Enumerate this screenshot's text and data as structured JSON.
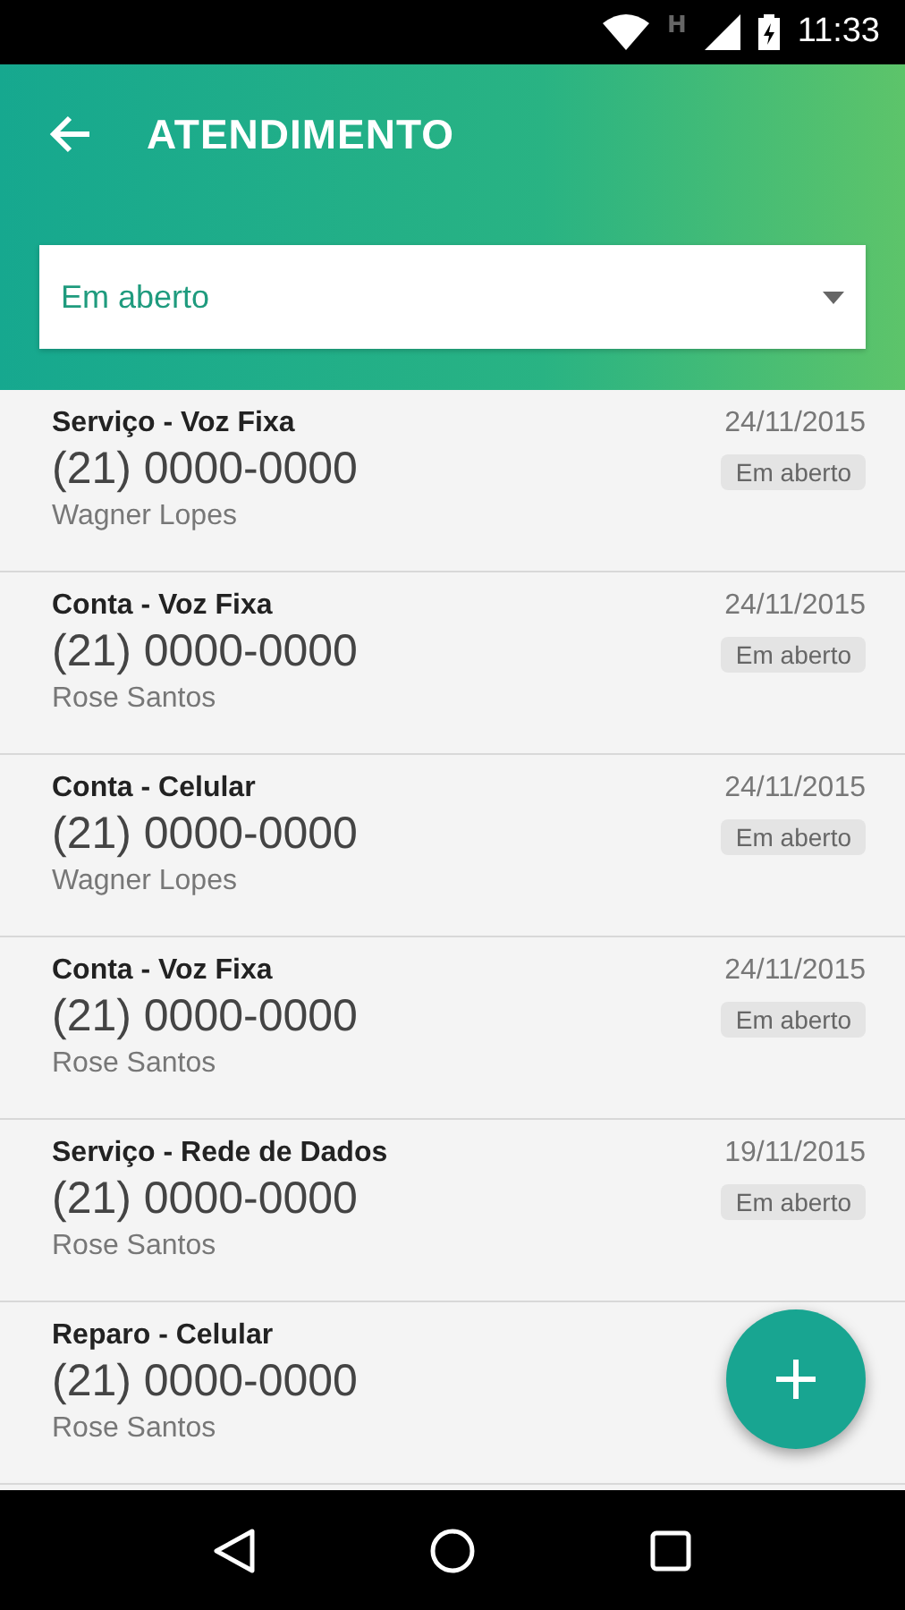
{
  "status_bar": {
    "network": "H",
    "time": "11:33"
  },
  "header": {
    "title": "ATENDIMENTO"
  },
  "filter": {
    "value": "Em aberto"
  },
  "tickets": [
    {
      "subject": "Serviço - Voz Fixa",
      "phone": "(21) 0000-0000",
      "name": "Wagner Lopes",
      "date": "24/11/2015",
      "status": "Em aberto"
    },
    {
      "subject": "Conta - Voz Fixa",
      "phone": "(21) 0000-0000",
      "name": "Rose Santos",
      "date": "24/11/2015",
      "status": "Em aberto"
    },
    {
      "subject": "Conta - Celular",
      "phone": "(21) 0000-0000",
      "name": "Wagner Lopes",
      "date": "24/11/2015",
      "status": "Em aberto"
    },
    {
      "subject": "Conta - Voz Fixa",
      "phone": "(21) 0000-0000",
      "name": "Rose Santos",
      "date": "24/11/2015",
      "status": "Em aberto"
    },
    {
      "subject": "Serviço - Rede de Dados",
      "phone": "(21) 0000-0000",
      "name": "Rose Santos",
      "date": "19/11/2015",
      "status": "Em aberto"
    },
    {
      "subject": "Reparo - Celular",
      "phone": "(21) 0000-0000",
      "name": "Rose Santos"
    }
  ]
}
